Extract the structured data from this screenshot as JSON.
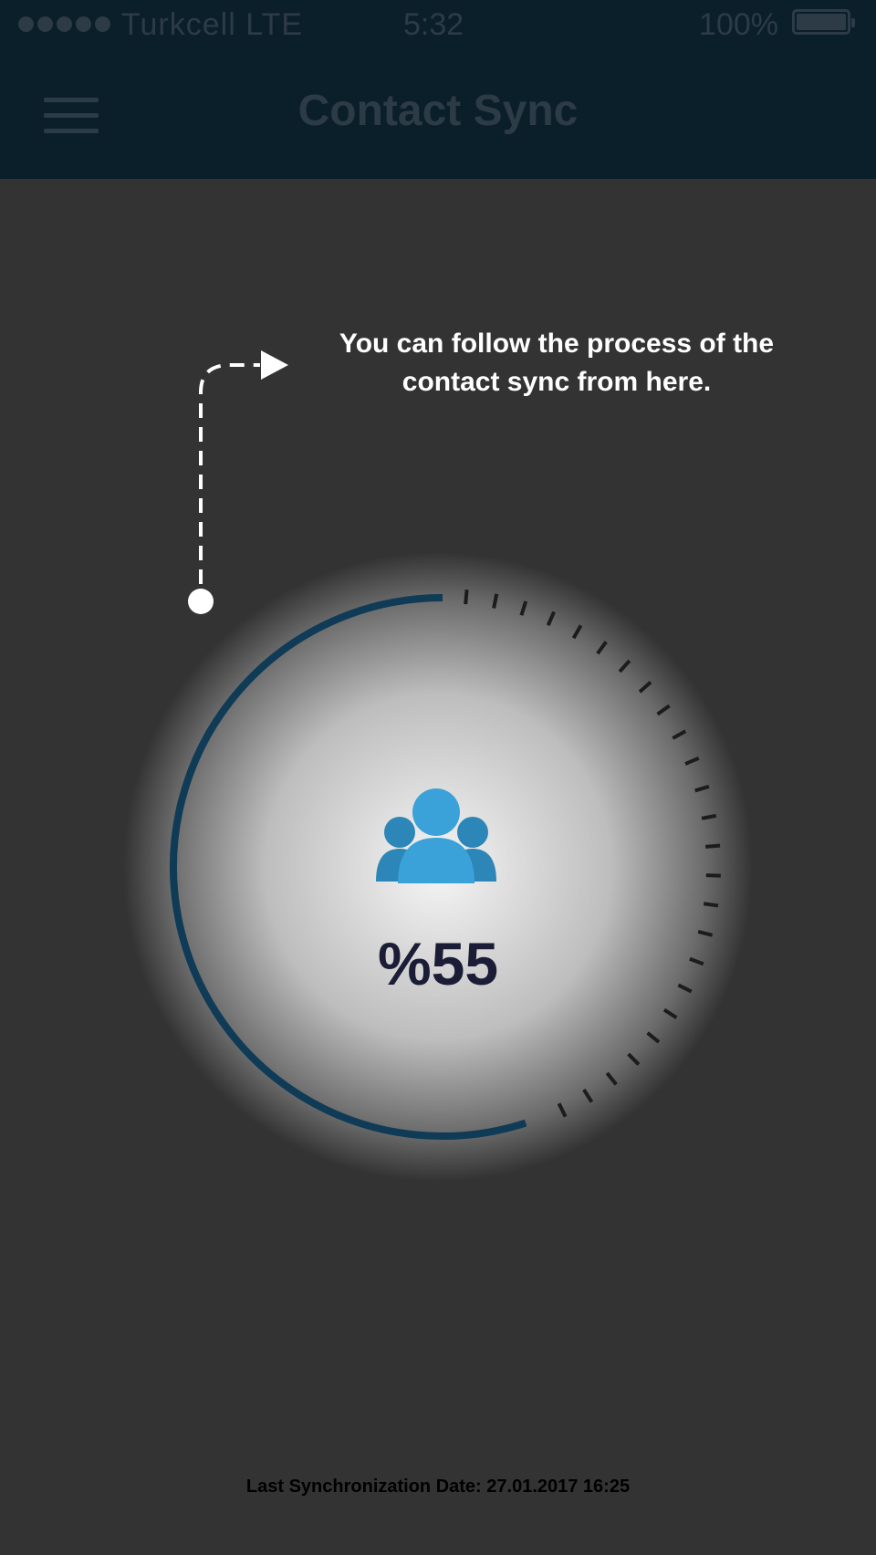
{
  "status_bar": {
    "carrier": "Turkcell  LTE",
    "time": "5:32",
    "battery": "100%",
    "signal_bars": 5
  },
  "header": {
    "title": "Contact Sync",
    "menu_icon": "hamburger-menu-icon"
  },
  "hint": {
    "text": "You can follow the process of the contact sync from here."
  },
  "progress": {
    "percent_label": "%55",
    "value": 55,
    "icon": "contacts-group-icon"
  },
  "footer": {
    "last_sync": "Last Synchronization Date: 27.01.2017 16:25"
  },
  "colors": {
    "bar_bg": "#0b1f2b",
    "page_bg": "#333333",
    "progress_arc": "#0f3b56",
    "icon_blue": "#3aa2d8",
    "percent_text": "#1b1d36"
  }
}
